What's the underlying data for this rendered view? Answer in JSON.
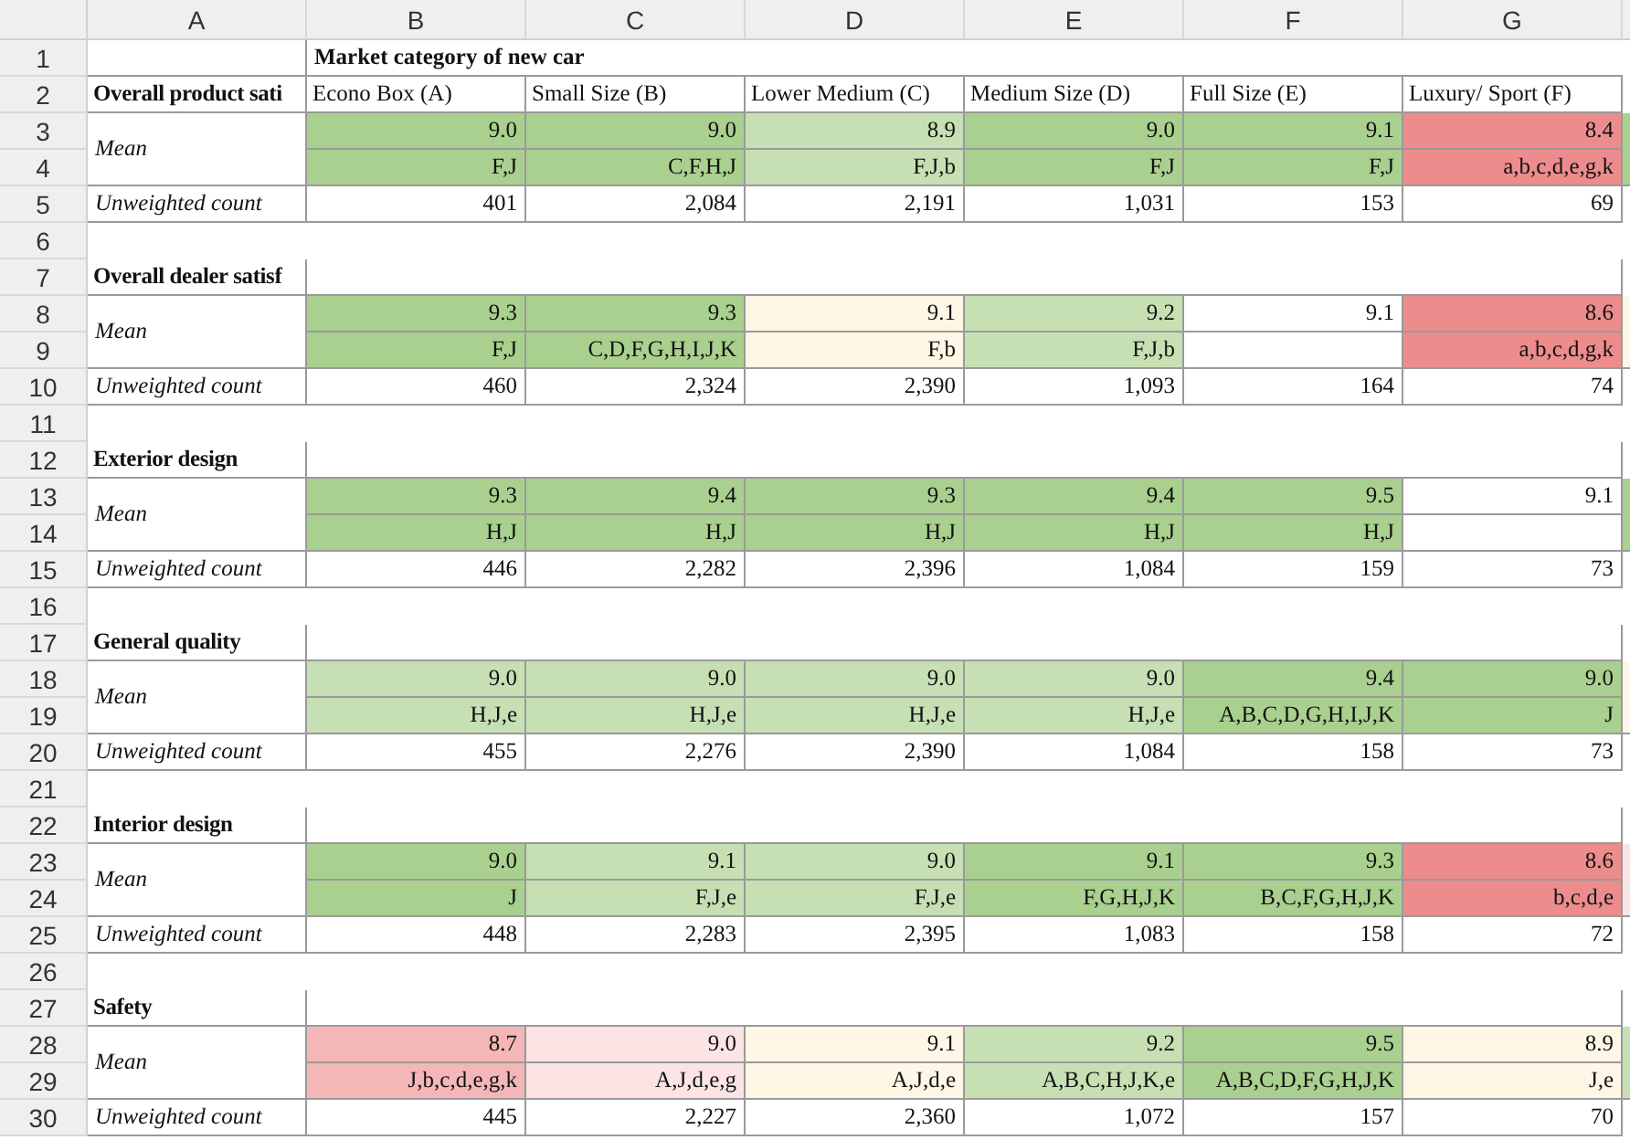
{
  "columns": [
    "A",
    "B",
    "C",
    "D",
    "E",
    "F",
    "G"
  ],
  "row_numbers": [
    "1",
    "2",
    "3",
    "4",
    "5",
    "6",
    "7",
    "8",
    "9",
    "10",
    "11",
    "12",
    "13",
    "14",
    "15",
    "16",
    "17",
    "18",
    "19",
    "20",
    "21",
    "22",
    "23",
    "24",
    "25",
    "26",
    "27",
    "28",
    "29",
    "30"
  ],
  "table_title": "Market category of new car",
  "sections": [
    {
      "title": "Overall product sati",
      "headers": [
        "Econo Box (A)",
        "Small Size (B)",
        "Lower Medium (C)",
        "Medium Size (D)",
        "Full Size (E)",
        "Luxury/ Sport (F)"
      ],
      "mean_label": "Mean",
      "count_label": "Unweighted count",
      "edge_cell": {
        "color": "#a9d08e"
      },
      "cells": [
        {
          "value": "9.0",
          "letters": "F,J",
          "color": "#a9d08e"
        },
        {
          "value": "9.0",
          "letters": "C,F,H,J",
          "color": "#a9d08e"
        },
        {
          "value": "8.9",
          "letters": "F,J,b",
          "color": "#c6e0b4"
        },
        {
          "value": "9.0",
          "letters": "F,J",
          "color": "#a9d08e"
        },
        {
          "value": "9.1",
          "letters": "F,J",
          "color": "#a9d08e"
        },
        {
          "value": "8.4",
          "letters": "a,b,c,d,e,g,k",
          "color": "#ec8c8c"
        }
      ],
      "counts": [
        "401",
        "2,084",
        "2,191",
        "1,031",
        "153",
        "69"
      ]
    },
    {
      "title": "Overall dealer satisf",
      "mean_label": "Mean",
      "count_label": "Unweighted count",
      "edge_cell": {
        "color": "#fff7e6"
      },
      "cells": [
        {
          "value": "9.3",
          "letters": "F,J",
          "color": "#a9d08e"
        },
        {
          "value": "9.3",
          "letters": "C,D,F,G,H,I,J,K",
          "color": "#a9d08e"
        },
        {
          "value": "9.1",
          "letters": "F,b",
          "color": "#fff7e6"
        },
        {
          "value": "9.2",
          "letters": "F,J,b",
          "color": "#c6e0b4"
        },
        {
          "value": "9.1",
          "color": "#ffffff"
        },
        {
          "value": "8.6",
          "letters": "a,b,c,d,g,k",
          "color": "#ec8c8c"
        }
      ],
      "counts": [
        "460",
        "2,324",
        "2,390",
        "1,093",
        "164",
        "74"
      ]
    },
    {
      "title": "Exterior design",
      "mean_label": "Mean",
      "count_label": "Unweighted count",
      "edge_cell": {
        "color": "#a9d08e"
      },
      "cells": [
        {
          "value": "9.3",
          "letters": "H,J",
          "color": "#a9d08e"
        },
        {
          "value": "9.4",
          "letters": "H,J",
          "color": "#a9d08e"
        },
        {
          "value": "9.3",
          "letters": "H,J",
          "color": "#a9d08e"
        },
        {
          "value": "9.4",
          "letters": "H,J",
          "color": "#a9d08e"
        },
        {
          "value": "9.5",
          "letters": "H,J",
          "color": "#a9d08e"
        },
        {
          "value": "9.1",
          "color": "#ffffff"
        }
      ],
      "counts": [
        "446",
        "2,282",
        "2,396",
        "1,084",
        "159",
        "73"
      ]
    },
    {
      "title": "General quality",
      "mean_label": "Mean",
      "count_label": "Unweighted count",
      "edge_cell": {
        "color": "#fff7e6"
      },
      "cells": [
        {
          "value": "9.0",
          "letters": "H,J,e",
          "color": "#c6e0b4"
        },
        {
          "value": "9.0",
          "letters": "H,J,e",
          "color": "#c6e0b4"
        },
        {
          "value": "9.0",
          "letters": "H,J,e",
          "color": "#c6e0b4"
        },
        {
          "value": "9.0",
          "letters": "H,J,e",
          "color": "#c6e0b4"
        },
        {
          "value": "9.4",
          "letters": "A,B,C,D,G,H,I,J,K",
          "color": "#a9d08e"
        },
        {
          "value": "9.0",
          "letters": "J",
          "color": "#a9d08e"
        }
      ],
      "counts": [
        "455",
        "2,276",
        "2,390",
        "1,084",
        "158",
        "73"
      ]
    },
    {
      "title": "Interior design",
      "mean_label": "Mean",
      "count_label": "Unweighted count",
      "edge_cell": {
        "color": "#fce4e4"
      },
      "cells": [
        {
          "value": "9.0",
          "letters": "J",
          "color": "#a9d08e"
        },
        {
          "value": "9.1",
          "letters": "F,J,e",
          "color": "#c6e0b4"
        },
        {
          "value": "9.0",
          "letters": "F,J,e",
          "color": "#c6e0b4"
        },
        {
          "value": "9.1",
          "letters": "F,G,H,J,K",
          "color": "#a9d08e"
        },
        {
          "value": "9.3",
          "letters": "B,C,F,G,H,J,K",
          "color": "#a9d08e"
        },
        {
          "value": "8.6",
          "letters": "b,c,d,e",
          "color": "#ec8c8c"
        }
      ],
      "counts": [
        "448",
        "2,283",
        "2,395",
        "1,083",
        "158",
        "72"
      ]
    },
    {
      "title": "Safety",
      "mean_label": "Mean",
      "count_label": "Unweighted count",
      "edge_cell": {
        "color": "#c6e0b4"
      },
      "cells": [
        {
          "value": "8.7",
          "letters": "J,b,c,d,e,g,k",
          "color": "#f4b6b6"
        },
        {
          "value": "9.0",
          "letters": "A,J,d,e,g",
          "color": "#fce4e4"
        },
        {
          "value": "9.1",
          "letters": "A,J,d,e",
          "color": "#fff7e6"
        },
        {
          "value": "9.2",
          "letters": "A,B,C,H,J,K,e",
          "color": "#c6e0b4"
        },
        {
          "value": "9.5",
          "letters": "A,B,C,D,F,G,H,J,K",
          "color": "#a9d08e"
        },
        {
          "value": "8.9",
          "letters": "J,e",
          "color": "#fff7e6"
        }
      ],
      "counts": [
        "445",
        "2,227",
        "2,360",
        "1,072",
        "157",
        "70"
      ]
    }
  ]
}
